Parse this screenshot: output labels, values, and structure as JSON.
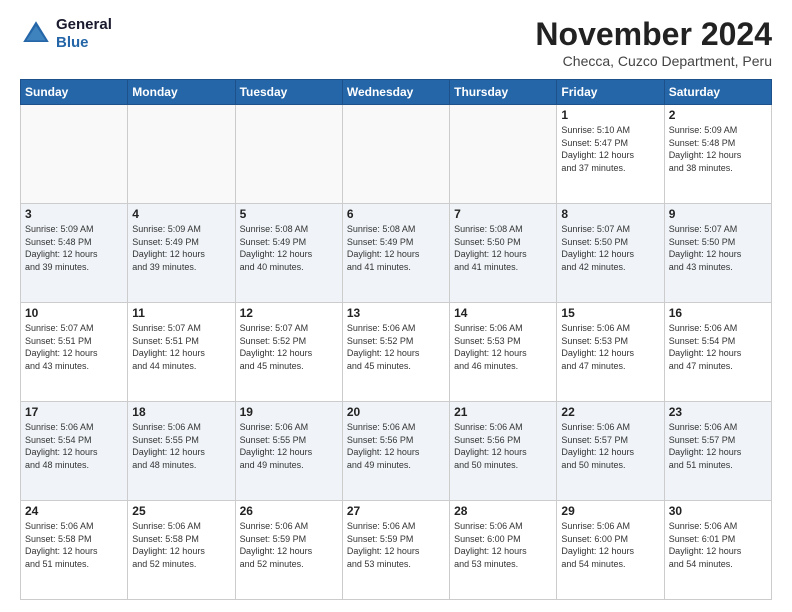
{
  "logo": {
    "line1": "General",
    "line2": "Blue"
  },
  "title": "November 2024",
  "location": "Checca, Cuzco Department, Peru",
  "headers": [
    "Sunday",
    "Monday",
    "Tuesday",
    "Wednesday",
    "Thursday",
    "Friday",
    "Saturday"
  ],
  "weeks": [
    {
      "shade": "white",
      "days": [
        {
          "num": "",
          "info": ""
        },
        {
          "num": "",
          "info": ""
        },
        {
          "num": "",
          "info": ""
        },
        {
          "num": "",
          "info": ""
        },
        {
          "num": "",
          "info": ""
        },
        {
          "num": "1",
          "info": "Sunrise: 5:10 AM\nSunset: 5:47 PM\nDaylight: 12 hours\nand 37 minutes."
        },
        {
          "num": "2",
          "info": "Sunrise: 5:09 AM\nSunset: 5:48 PM\nDaylight: 12 hours\nand 38 minutes."
        }
      ]
    },
    {
      "shade": "shade",
      "days": [
        {
          "num": "3",
          "info": "Sunrise: 5:09 AM\nSunset: 5:48 PM\nDaylight: 12 hours\nand 39 minutes."
        },
        {
          "num": "4",
          "info": "Sunrise: 5:09 AM\nSunset: 5:49 PM\nDaylight: 12 hours\nand 39 minutes."
        },
        {
          "num": "5",
          "info": "Sunrise: 5:08 AM\nSunset: 5:49 PM\nDaylight: 12 hours\nand 40 minutes."
        },
        {
          "num": "6",
          "info": "Sunrise: 5:08 AM\nSunset: 5:49 PM\nDaylight: 12 hours\nand 41 minutes."
        },
        {
          "num": "7",
          "info": "Sunrise: 5:08 AM\nSunset: 5:50 PM\nDaylight: 12 hours\nand 41 minutes."
        },
        {
          "num": "8",
          "info": "Sunrise: 5:07 AM\nSunset: 5:50 PM\nDaylight: 12 hours\nand 42 minutes."
        },
        {
          "num": "9",
          "info": "Sunrise: 5:07 AM\nSunset: 5:50 PM\nDaylight: 12 hours\nand 43 minutes."
        }
      ]
    },
    {
      "shade": "white",
      "days": [
        {
          "num": "10",
          "info": "Sunrise: 5:07 AM\nSunset: 5:51 PM\nDaylight: 12 hours\nand 43 minutes."
        },
        {
          "num": "11",
          "info": "Sunrise: 5:07 AM\nSunset: 5:51 PM\nDaylight: 12 hours\nand 44 minutes."
        },
        {
          "num": "12",
          "info": "Sunrise: 5:07 AM\nSunset: 5:52 PM\nDaylight: 12 hours\nand 45 minutes."
        },
        {
          "num": "13",
          "info": "Sunrise: 5:06 AM\nSunset: 5:52 PM\nDaylight: 12 hours\nand 45 minutes."
        },
        {
          "num": "14",
          "info": "Sunrise: 5:06 AM\nSunset: 5:53 PM\nDaylight: 12 hours\nand 46 minutes."
        },
        {
          "num": "15",
          "info": "Sunrise: 5:06 AM\nSunset: 5:53 PM\nDaylight: 12 hours\nand 47 minutes."
        },
        {
          "num": "16",
          "info": "Sunrise: 5:06 AM\nSunset: 5:54 PM\nDaylight: 12 hours\nand 47 minutes."
        }
      ]
    },
    {
      "shade": "shade",
      "days": [
        {
          "num": "17",
          "info": "Sunrise: 5:06 AM\nSunset: 5:54 PM\nDaylight: 12 hours\nand 48 minutes."
        },
        {
          "num": "18",
          "info": "Sunrise: 5:06 AM\nSunset: 5:55 PM\nDaylight: 12 hours\nand 48 minutes."
        },
        {
          "num": "19",
          "info": "Sunrise: 5:06 AM\nSunset: 5:55 PM\nDaylight: 12 hours\nand 49 minutes."
        },
        {
          "num": "20",
          "info": "Sunrise: 5:06 AM\nSunset: 5:56 PM\nDaylight: 12 hours\nand 49 minutes."
        },
        {
          "num": "21",
          "info": "Sunrise: 5:06 AM\nSunset: 5:56 PM\nDaylight: 12 hours\nand 50 minutes."
        },
        {
          "num": "22",
          "info": "Sunrise: 5:06 AM\nSunset: 5:57 PM\nDaylight: 12 hours\nand 50 minutes."
        },
        {
          "num": "23",
          "info": "Sunrise: 5:06 AM\nSunset: 5:57 PM\nDaylight: 12 hours\nand 51 minutes."
        }
      ]
    },
    {
      "shade": "white",
      "days": [
        {
          "num": "24",
          "info": "Sunrise: 5:06 AM\nSunset: 5:58 PM\nDaylight: 12 hours\nand 51 minutes."
        },
        {
          "num": "25",
          "info": "Sunrise: 5:06 AM\nSunset: 5:58 PM\nDaylight: 12 hours\nand 52 minutes."
        },
        {
          "num": "26",
          "info": "Sunrise: 5:06 AM\nSunset: 5:59 PM\nDaylight: 12 hours\nand 52 minutes."
        },
        {
          "num": "27",
          "info": "Sunrise: 5:06 AM\nSunset: 5:59 PM\nDaylight: 12 hours\nand 53 minutes."
        },
        {
          "num": "28",
          "info": "Sunrise: 5:06 AM\nSunset: 6:00 PM\nDaylight: 12 hours\nand 53 minutes."
        },
        {
          "num": "29",
          "info": "Sunrise: 5:06 AM\nSunset: 6:00 PM\nDaylight: 12 hours\nand 54 minutes."
        },
        {
          "num": "30",
          "info": "Sunrise: 5:06 AM\nSunset: 6:01 PM\nDaylight: 12 hours\nand 54 minutes."
        }
      ]
    }
  ]
}
